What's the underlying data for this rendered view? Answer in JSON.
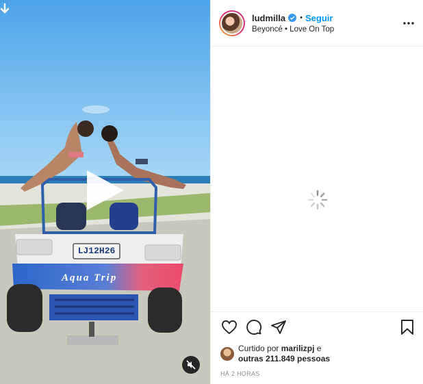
{
  "post": {
    "username": "ludmilla",
    "follow_label": "Seguir",
    "separator": "•",
    "audio": "Beyoncé • Love On Top",
    "plate": "LJ12H26",
    "buggy_text": "Aqua Trip",
    "liked_prefix": "Curtido por",
    "liked_by": "marilizpj",
    "liked_mid": "e",
    "liked_others": "outras 211.849 pessoas",
    "time": "HÁ 2 HORAS"
  },
  "icons": {
    "download": "download-arrow-icon",
    "play": "play-icon",
    "mute": "muted-speaker-icon",
    "verified": "verified-badge-icon",
    "more": "more-options-icon",
    "spinner": "loading-spinner-icon",
    "like": "heart-icon",
    "comment": "comment-icon",
    "share": "send-icon",
    "save": "bookmark-icon"
  },
  "colors": {
    "link": "#0095f6",
    "text": "#262626",
    "muted": "#8e8e8e",
    "verified": "#3897f0"
  }
}
